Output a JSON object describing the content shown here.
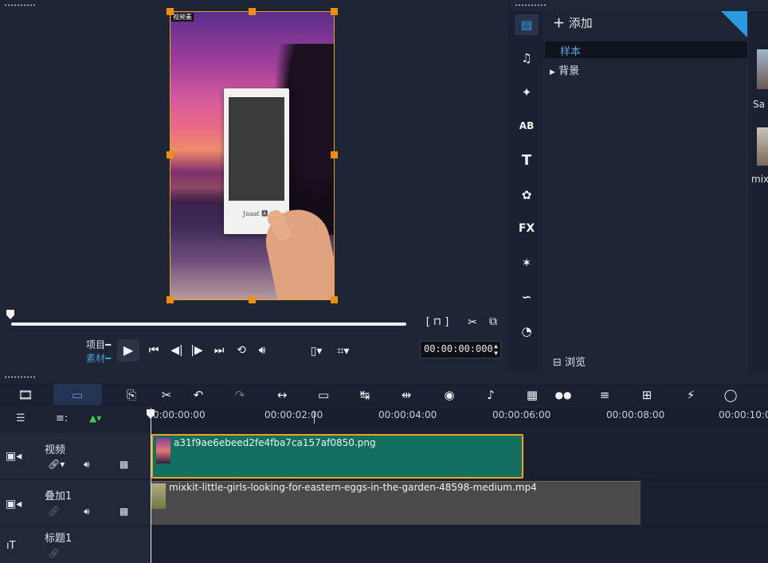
{
  "colors": {
    "accent_orange": "#f0a21f",
    "video_clip": "#117060",
    "overlay_clip": "#4a4a4a",
    "library_selected_text": "#5aa8e6",
    "pin": "#2a9bde"
  },
  "player": {
    "preview_watermark": "视频素",
    "card_signature": "Jaaat 🅰",
    "segment": {
      "project": "项目",
      "clip": "素材"
    },
    "timecode": "00:00:00:000",
    "icons": [
      "play-icon",
      "go-start-icon",
      "prev-frame-icon",
      "next-frame-icon",
      "go-end-icon",
      "repeat-icon",
      "volume-icon",
      "device-icon",
      "resize-icon",
      "split-icon",
      "enlarge-icon"
    ]
  },
  "library": {
    "add_label": "添加",
    "items": [
      "样本",
      "背景"
    ],
    "browse_label": "浏览",
    "thumb_labels": [
      "Sa",
      "mix"
    ],
    "rail_icons": [
      "media-icon",
      "audio-icon",
      "transition-icon",
      "ab-icon",
      "title-icon",
      "graphics-icon",
      "fx-icon",
      "magic-icon",
      "path-icon",
      "speed-icon"
    ],
    "rail_glyphs": [
      "▤",
      "♫",
      "✦",
      "AB",
      "T",
      "✿",
      "FX",
      "✶",
      "∽",
      "◔"
    ]
  },
  "toolbar": {
    "glyphs": [
      "⎘",
      "✂",
      "↶",
      "↷",
      "↔",
      "▭",
      "↹",
      "⇹",
      "◉",
      "♪",
      "▦",
      "●●",
      "≡",
      "⊞",
      "⚡",
      "◯"
    ],
    "names": [
      "record-icon",
      "tools-icon",
      "undo-icon",
      "redo-icon",
      "fit-icon",
      "crop-icon",
      "split-screen-icon",
      "motion-icon",
      "color-icon",
      "audio-mix-icon",
      "mosaic-icon",
      "mask-icon",
      "subtitle-icon",
      "multicam-icon",
      "speed-ramp-icon",
      "lasso-icon"
    ]
  },
  "timeline": {
    "ruler": [
      "0:00:00:00",
      "00:00:02:00",
      "00:00:04:00",
      "00:00:06:00",
      "00:00:08:00",
      "00:00:10:0"
    ],
    "tracks": [
      {
        "name": "视频",
        "type": "video"
      },
      {
        "name": "叠加1",
        "type": "overlay"
      },
      {
        "name": "标题1",
        "type": "title"
      }
    ],
    "clips": {
      "video": "a31f9ae6ebeed2fe4fba7ca157af0850.png",
      "overlay": "mixkit-little-girls-looking-for-eastern-eggs-in-the-garden-48598-medium.mp4"
    }
  }
}
